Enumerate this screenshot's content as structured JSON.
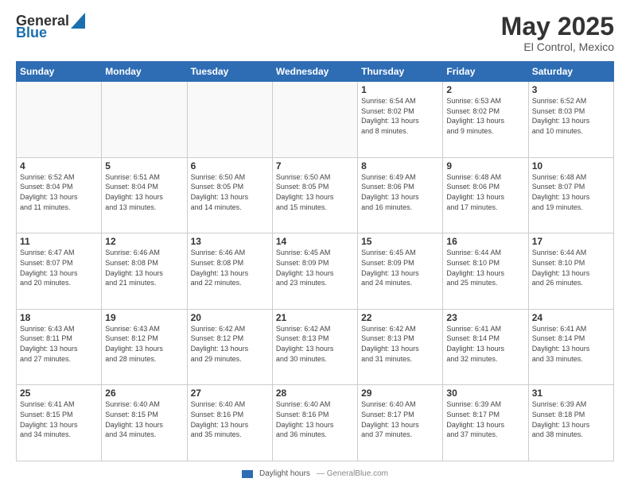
{
  "header": {
    "logo_general": "General",
    "logo_blue": "Blue",
    "month": "May 2025",
    "location": "El Control, Mexico"
  },
  "calendar": {
    "days_of_week": [
      "Sunday",
      "Monday",
      "Tuesday",
      "Wednesday",
      "Thursday",
      "Friday",
      "Saturday"
    ],
    "weeks": [
      [
        {
          "day": "",
          "info": ""
        },
        {
          "day": "",
          "info": ""
        },
        {
          "day": "",
          "info": ""
        },
        {
          "day": "",
          "info": ""
        },
        {
          "day": "1",
          "info": "Sunrise: 6:54 AM\nSunset: 8:02 PM\nDaylight: 13 hours\nand 8 minutes."
        },
        {
          "day": "2",
          "info": "Sunrise: 6:53 AM\nSunset: 8:02 PM\nDaylight: 13 hours\nand 9 minutes."
        },
        {
          "day": "3",
          "info": "Sunrise: 6:52 AM\nSunset: 8:03 PM\nDaylight: 13 hours\nand 10 minutes."
        }
      ],
      [
        {
          "day": "4",
          "info": "Sunrise: 6:52 AM\nSunset: 8:04 PM\nDaylight: 13 hours\nand 11 minutes."
        },
        {
          "day": "5",
          "info": "Sunrise: 6:51 AM\nSunset: 8:04 PM\nDaylight: 13 hours\nand 13 minutes."
        },
        {
          "day": "6",
          "info": "Sunrise: 6:50 AM\nSunset: 8:05 PM\nDaylight: 13 hours\nand 14 minutes."
        },
        {
          "day": "7",
          "info": "Sunrise: 6:50 AM\nSunset: 8:05 PM\nDaylight: 13 hours\nand 15 minutes."
        },
        {
          "day": "8",
          "info": "Sunrise: 6:49 AM\nSunset: 8:06 PM\nDaylight: 13 hours\nand 16 minutes."
        },
        {
          "day": "9",
          "info": "Sunrise: 6:48 AM\nSunset: 8:06 PM\nDaylight: 13 hours\nand 17 minutes."
        },
        {
          "day": "10",
          "info": "Sunrise: 6:48 AM\nSunset: 8:07 PM\nDaylight: 13 hours\nand 19 minutes."
        }
      ],
      [
        {
          "day": "11",
          "info": "Sunrise: 6:47 AM\nSunset: 8:07 PM\nDaylight: 13 hours\nand 20 minutes."
        },
        {
          "day": "12",
          "info": "Sunrise: 6:46 AM\nSunset: 8:08 PM\nDaylight: 13 hours\nand 21 minutes."
        },
        {
          "day": "13",
          "info": "Sunrise: 6:46 AM\nSunset: 8:08 PM\nDaylight: 13 hours\nand 22 minutes."
        },
        {
          "day": "14",
          "info": "Sunrise: 6:45 AM\nSunset: 8:09 PM\nDaylight: 13 hours\nand 23 minutes."
        },
        {
          "day": "15",
          "info": "Sunrise: 6:45 AM\nSunset: 8:09 PM\nDaylight: 13 hours\nand 24 minutes."
        },
        {
          "day": "16",
          "info": "Sunrise: 6:44 AM\nSunset: 8:10 PM\nDaylight: 13 hours\nand 25 minutes."
        },
        {
          "day": "17",
          "info": "Sunrise: 6:44 AM\nSunset: 8:10 PM\nDaylight: 13 hours\nand 26 minutes."
        }
      ],
      [
        {
          "day": "18",
          "info": "Sunrise: 6:43 AM\nSunset: 8:11 PM\nDaylight: 13 hours\nand 27 minutes."
        },
        {
          "day": "19",
          "info": "Sunrise: 6:43 AM\nSunset: 8:12 PM\nDaylight: 13 hours\nand 28 minutes."
        },
        {
          "day": "20",
          "info": "Sunrise: 6:42 AM\nSunset: 8:12 PM\nDaylight: 13 hours\nand 29 minutes."
        },
        {
          "day": "21",
          "info": "Sunrise: 6:42 AM\nSunset: 8:13 PM\nDaylight: 13 hours\nand 30 minutes."
        },
        {
          "day": "22",
          "info": "Sunrise: 6:42 AM\nSunset: 8:13 PM\nDaylight: 13 hours\nand 31 minutes."
        },
        {
          "day": "23",
          "info": "Sunrise: 6:41 AM\nSunset: 8:14 PM\nDaylight: 13 hours\nand 32 minutes."
        },
        {
          "day": "24",
          "info": "Sunrise: 6:41 AM\nSunset: 8:14 PM\nDaylight: 13 hours\nand 33 minutes."
        }
      ],
      [
        {
          "day": "25",
          "info": "Sunrise: 6:41 AM\nSunset: 8:15 PM\nDaylight: 13 hours\nand 34 minutes."
        },
        {
          "day": "26",
          "info": "Sunrise: 6:40 AM\nSunset: 8:15 PM\nDaylight: 13 hours\nand 34 minutes."
        },
        {
          "day": "27",
          "info": "Sunrise: 6:40 AM\nSunset: 8:16 PM\nDaylight: 13 hours\nand 35 minutes."
        },
        {
          "day": "28",
          "info": "Sunrise: 6:40 AM\nSunset: 8:16 PM\nDaylight: 13 hours\nand 36 minutes."
        },
        {
          "day": "29",
          "info": "Sunrise: 6:40 AM\nSunset: 8:17 PM\nDaylight: 13 hours\nand 37 minutes."
        },
        {
          "day": "30",
          "info": "Sunrise: 6:39 AM\nSunset: 8:17 PM\nDaylight: 13 hours\nand 37 minutes."
        },
        {
          "day": "31",
          "info": "Sunrise: 6:39 AM\nSunset: 8:18 PM\nDaylight: 13 hours\nand 38 minutes."
        }
      ]
    ]
  },
  "footer": {
    "label": "Daylight hours",
    "source": "GeneralBlue.com"
  }
}
